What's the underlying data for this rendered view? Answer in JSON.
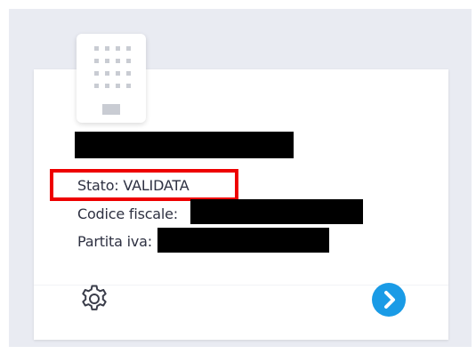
{
  "company": {
    "status_line": "Stato: VALIDATA",
    "tax_code_label": "Codice fiscale:",
    "vat_label": "Partita iva:"
  },
  "icons": {
    "logo": "building-icon",
    "settings": "gear-icon",
    "next": "chevron-right-icon"
  },
  "colors": {
    "highlight": "#ee0000",
    "accent": "#1a9be6",
    "background": "#e9ebf2"
  }
}
